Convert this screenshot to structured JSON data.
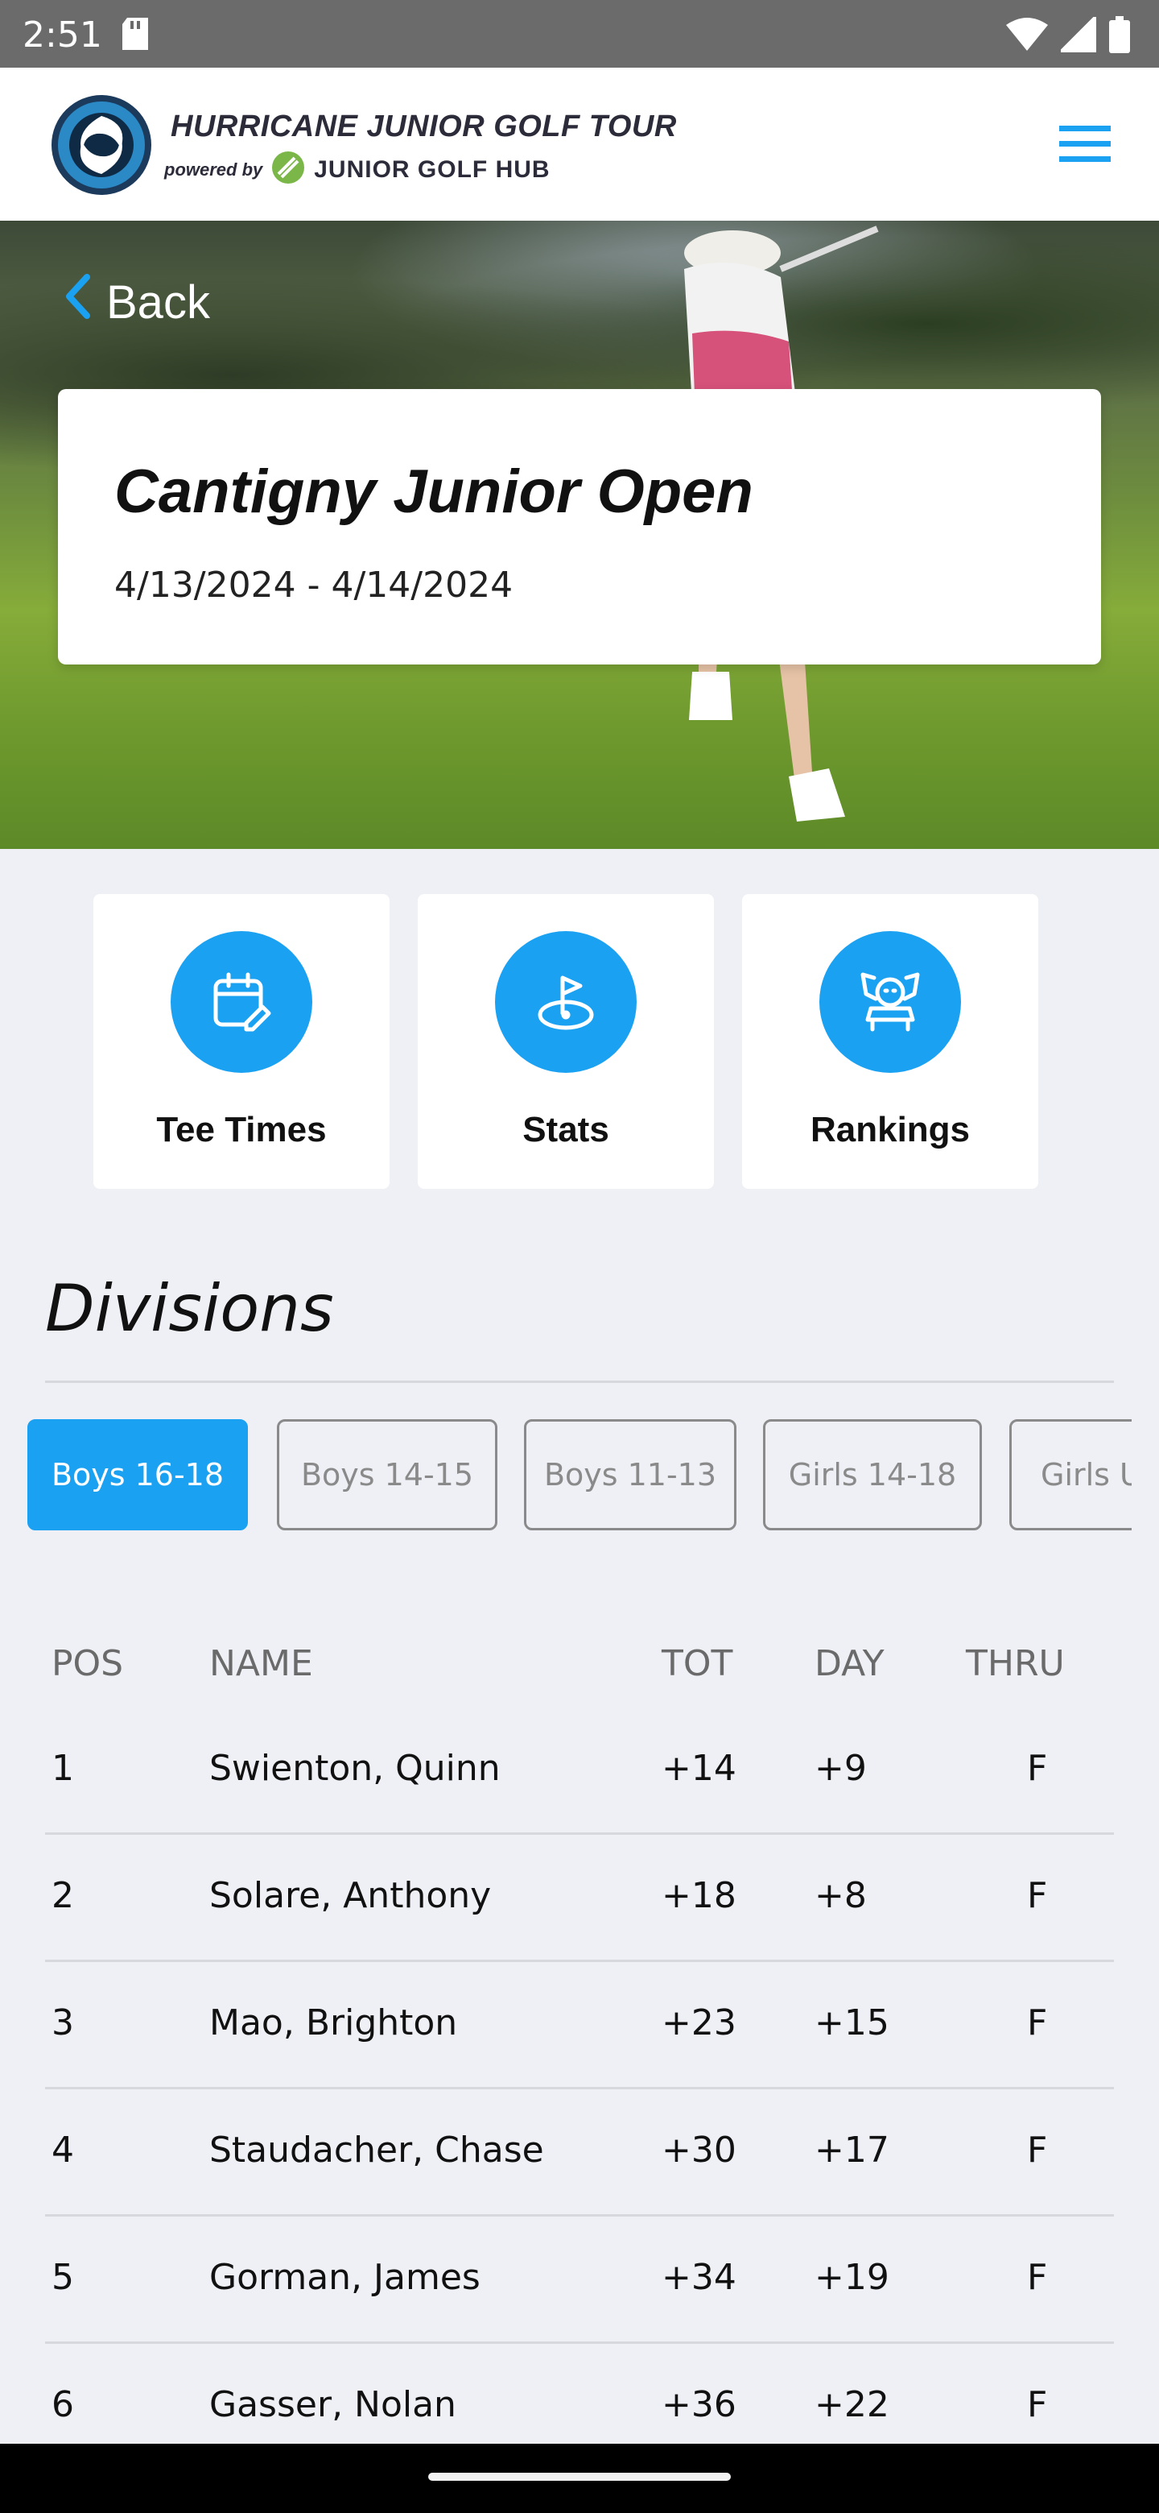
{
  "status_bar": {
    "time": "2:51"
  },
  "header": {
    "brand_title": "HURRICANE JUNIOR GOLF TOUR",
    "powered_by": "powered by",
    "partner": "JUNIOR GOLF HUB"
  },
  "hero": {
    "back_label": "Back"
  },
  "event": {
    "title": "Cantigny Junior Open",
    "dates": "4/13/2024 - 4/14/2024"
  },
  "actions": [
    {
      "label": "Tee Times",
      "icon": "calendar-edit-icon"
    },
    {
      "label": "Stats",
      "icon": "golf-flag-icon"
    },
    {
      "label": "Rankings",
      "icon": "trophy-icon"
    }
  ],
  "divisions": {
    "title": "Divisions",
    "tabs": [
      "Boys 16-18",
      "Boys 14-15",
      "Boys 11-13",
      "Girls 14-18",
      "Girls U"
    ],
    "active_index": 0
  },
  "leaderboard": {
    "columns": {
      "pos": "POS",
      "name": "NAME",
      "tot": "TOT",
      "day": "DAY",
      "thru": "THRU"
    },
    "rows": [
      {
        "pos": "1",
        "name": "Swienton, Quinn",
        "tot": "+14",
        "day": "+9",
        "thru": "F"
      },
      {
        "pos": "2",
        "name": "Solare, Anthony",
        "tot": "+18",
        "day": "+8",
        "thru": "F"
      },
      {
        "pos": "3",
        "name": "Mao, Brighton",
        "tot": "+23",
        "day": "+15",
        "thru": "F"
      },
      {
        "pos": "4",
        "name": "Staudacher, Chase",
        "tot": "+30",
        "day": "+17",
        "thru": "F"
      },
      {
        "pos": "5",
        "name": "Gorman, James",
        "tot": "+34",
        "day": "+19",
        "thru": "F"
      },
      {
        "pos": "6",
        "name": "Gasser, Nolan",
        "tot": "+36",
        "day": "+22",
        "thru": "F"
      }
    ]
  },
  "colors": {
    "accent": "#1ba1f2",
    "background": "#eef0f5"
  }
}
